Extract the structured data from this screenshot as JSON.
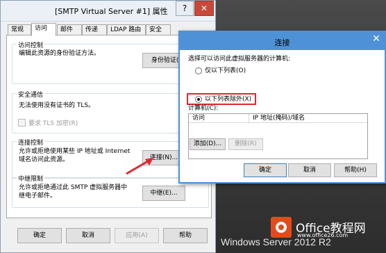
{
  "main_dialog": {
    "title": "[SMTP Virtual Server #1] 属性",
    "help_glyph": "?",
    "close_glyph": "✕",
    "tabs": [
      "常规",
      "访问",
      "邮件",
      "传递",
      "LDAP 路由",
      "安全"
    ],
    "active_tab": "访问",
    "access_control": {
      "title": "访问控制",
      "description": "编辑此资源的身份验证方法。",
      "button": "身份验证(U)..."
    },
    "secure_comm": {
      "title": "安全通信",
      "description": "无法使用没有证书的 TLS。",
      "checkbox_label": "要求 TLS 加密(R)"
    },
    "connection_control": {
      "title": "连接控制",
      "description_line1": "允许或拒绝使用某些 IP 地址或 Internet",
      "description_line2": "域名访问此资源。",
      "button": "连接(N)..."
    },
    "relay_restrictions": {
      "title": "中继限制",
      "description_line1": "允许或拒绝通过此 SMTP 虚拟服务器中",
      "description_line2": "继电子邮件。",
      "button": "中继(E)..."
    },
    "footer": {
      "ok": "确定",
      "cancel": "取消",
      "apply": "应用(A)",
      "help": "帮助"
    }
  },
  "connection_dialog": {
    "title": "连接",
    "close_glyph": "✕",
    "prompt": "选择可以访问此虚拟服务器的计算机:",
    "radio_only_list": "仅以下列表(O)",
    "radio_all_except": "以下列表除外(X)",
    "selected_option": "radio_all_except",
    "list_label": "计算机(C):",
    "columns": [
      "访问",
      "IP 地址(掩码)/域名"
    ],
    "add_button": "添加(D)...",
    "remove_button": "删除(R)",
    "ok": "确定",
    "cancel": "取消",
    "help": "帮助(H)"
  },
  "desktop": {
    "os_watermark": "Windows Server 2012 R2",
    "logo_text": "Office教程网",
    "logo_url": "www.office26.com"
  },
  "colors": {
    "accent_blue": "#4f91d6",
    "highlight_red": "#e0262f",
    "logo_orange": "#e64a19"
  }
}
